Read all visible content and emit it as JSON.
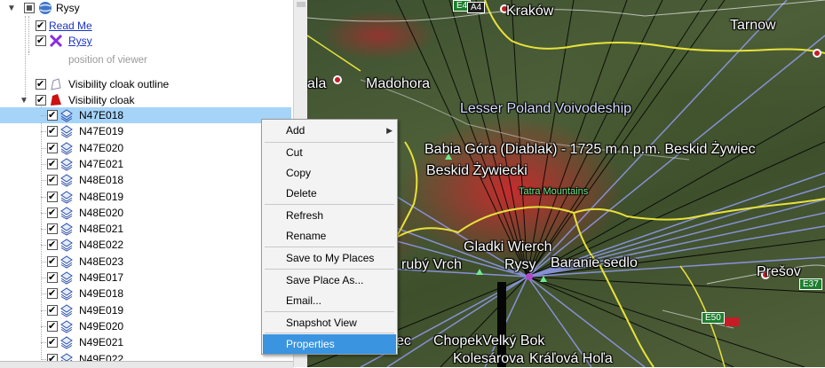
{
  "tree": {
    "root": "Rysy",
    "read_me": "Read Me",
    "rysy_link": "Rysy",
    "position_note": "position of viewer",
    "outline": "Visibility cloak outline",
    "cloak": "Visibility cloak",
    "tiles": [
      "N47E018",
      "N47E019",
      "N47E020",
      "N47E021",
      "N48E018",
      "N48E019",
      "N48E020",
      "N48E021",
      "N48E022",
      "N48E023",
      "N49E017",
      "N49E018",
      "N49E019",
      "N49E020",
      "N49E021",
      "N49E022"
    ],
    "selected_tile": "N47E018"
  },
  "map": {
    "labels": {
      "krakow": "Kraków",
      "tarnow": "Tarnow",
      "madohora": "Madohora",
      "ala": "ala",
      "lesser_poland": "Lesser Poland Voivodeship",
      "babia_gora": "Babia Góra (Diablak) -  1725 m n.p.m.  Beskid Żywiec",
      "beskid": "Beskid Żywiecki",
      "tatra": "Tatra Mountains",
      "gladki": "Gladki Wierch",
      "ruby": "rubý Vrch",
      "rysy": "Rysy",
      "baranie": "Baranie sedlo",
      "presov": "Prešov",
      "chopek": "ChopekVelký Bok",
      "ec": "ec",
      "kolesarova": "Kolesárova",
      "kralova": "Kráľová Hoľa"
    },
    "shields": {
      "a4": "A4",
      "e4": "E4",
      "e50": "E50",
      "e37": "E37"
    }
  },
  "context_menu": {
    "items": [
      {
        "label": "Add",
        "submenu": true
      },
      {
        "label": "Cut"
      },
      {
        "label": "Copy"
      },
      {
        "label": "Delete"
      },
      {
        "label": "Refresh"
      },
      {
        "label": "Rename"
      },
      {
        "label": "Save to My Places"
      },
      {
        "label": "Save Place As..."
      },
      {
        "label": "Email..."
      },
      {
        "label": "Snapshot View"
      },
      {
        "label": "Properties"
      }
    ],
    "highlighted": "Properties"
  }
}
